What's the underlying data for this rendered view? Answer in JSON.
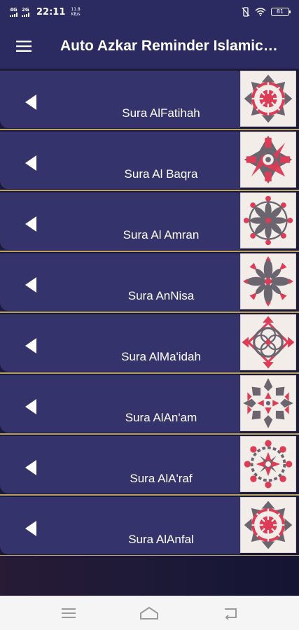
{
  "status": {
    "net1": "4G",
    "net2": "2G",
    "time": "22:11",
    "speed_value": "11.8",
    "speed_unit": "KB/s",
    "battery": "81"
  },
  "app": {
    "title": "Auto Azkar Reminder Islamic…"
  },
  "suras": [
    {
      "label": "Sura AlFatihah"
    },
    {
      "label": "Sura Al Baqra"
    },
    {
      "label": "Sura Al Amran"
    },
    {
      "label": "Sura AnNisa"
    },
    {
      "label": "Sura AlMa'idah"
    },
    {
      "label": "Sura AlAn'am"
    },
    {
      "label": "Sura AlA'raf"
    },
    {
      "label": "Sura AlAnfal"
    }
  ],
  "colors": {
    "appbar": "#2b2b62",
    "card": "#34336c",
    "divider": "#b7a464",
    "pattern_red": "#dc3c55",
    "pattern_grey": "#6b6570"
  },
  "icons": {
    "menu": "hamburger-menu-icon",
    "row": "play-left-triangle-icon",
    "nav": [
      "recent-apps-icon",
      "home-icon",
      "back-icon"
    ]
  }
}
